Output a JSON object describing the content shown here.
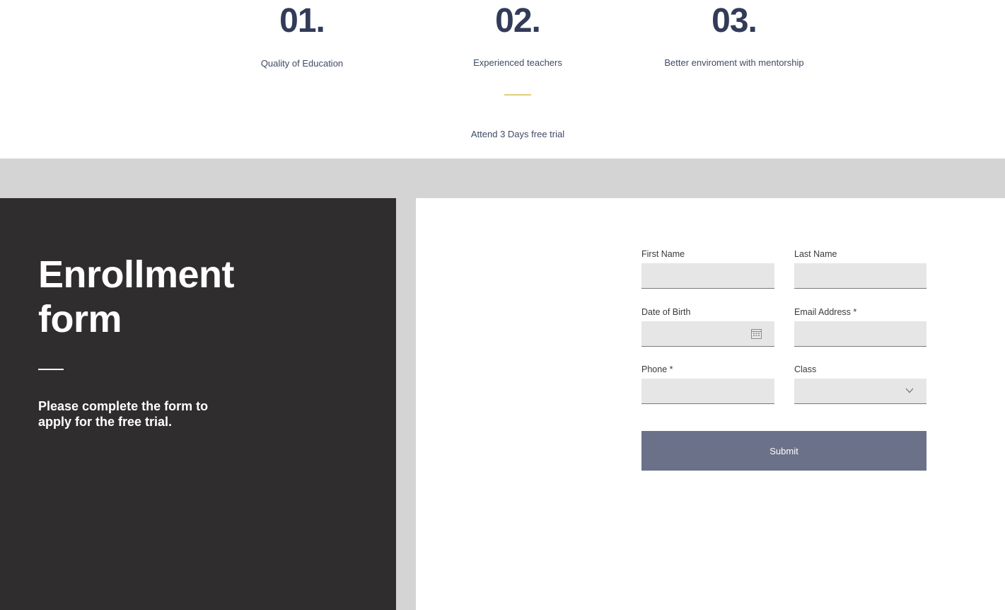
{
  "features": [
    {
      "number": "01.",
      "label": "Quality of Education"
    },
    {
      "number": "02.",
      "label": "Experienced teachers"
    },
    {
      "number": "03.",
      "label": "Better enviroment with mentorship"
    }
  ],
  "trial_text": "Attend 3 Days free trial",
  "enrollment": {
    "title_line1": "Enrollment",
    "title_line2": "form",
    "subtitle": "Please complete the form to apply for the free trial."
  },
  "form": {
    "first_name_label": "First Name",
    "last_name_label": "Last Name",
    "dob_label": "Date of Birth",
    "email_label": "Email Address *",
    "phone_label": "Phone *",
    "class_label": "Class",
    "first_name_value": "",
    "last_name_value": "",
    "dob_value": "",
    "email_value": "",
    "phone_value": "",
    "class_value": "",
    "submit_label": "Submit"
  },
  "icons": {
    "date_picker": "calendar-icon",
    "class_dropdown": "chevron-down-icon"
  },
  "colors": {
    "number_navy": "#323b58",
    "gold_accent": "#e2cd7c",
    "dark_panel": "#2f2d2e",
    "submit_button": "#6b7189",
    "input_fill": "#e6e6e6"
  }
}
